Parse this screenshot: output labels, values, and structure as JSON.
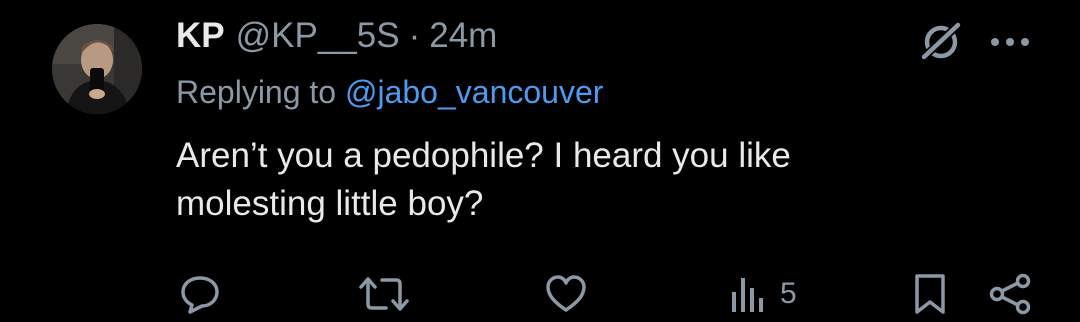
{
  "tweet": {
    "display_name": "KP",
    "handle": "@KP__5S",
    "separator": "·",
    "time": "24m",
    "replying_prefix": "Replying to ",
    "replying_to": "@jabo_vancouver",
    "text_line1": "Aren’t you a pedophile? I heard you like",
    "text_line2": "molesting little boy?"
  },
  "actions": {
    "views_count": "5"
  },
  "icons": {
    "avatar": "avatar",
    "grok": "grok-icon",
    "more": "more-icon",
    "reply": "reply-icon",
    "retweet": "retweet-icon",
    "like": "heart-icon",
    "views": "views-icon",
    "bookmark": "bookmark-icon",
    "share": "share-icon"
  },
  "colors": {
    "background": "#000000",
    "primary_text": "#e7e9ea",
    "secondary_text": "#8b98a5",
    "mention": "#4d9bf0"
  }
}
